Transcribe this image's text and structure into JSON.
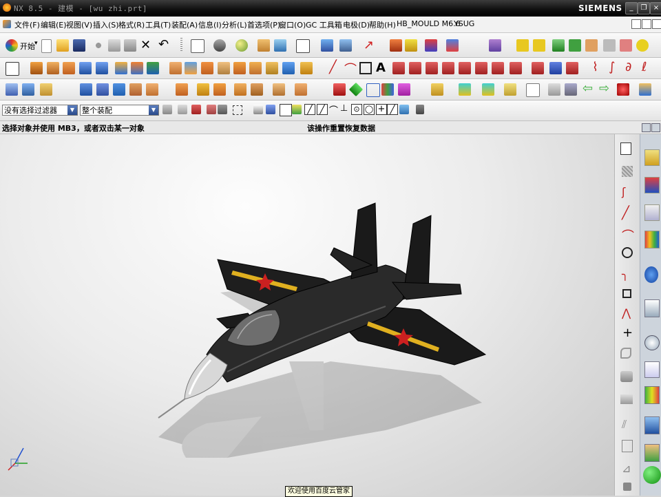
{
  "window": {
    "title": "NX 8.5 - 建模 - [wu zhi.prt]",
    "brand": "SIEMENS",
    "controls": [
      "_",
      "❐",
      "×"
    ]
  },
  "menubar": {
    "items": [
      {
        "label": "文件(F)"
      },
      {
        "label": "编辑(E)"
      },
      {
        "label": "视图(V)"
      },
      {
        "label": "插入(S)"
      },
      {
        "label": "格式(R)"
      },
      {
        "label": "工具(T)"
      },
      {
        "label": "装配(A)"
      },
      {
        "label": "信息(I)"
      },
      {
        "label": "分析(L)"
      },
      {
        "label": "首选项(P)"
      },
      {
        "label": "窗口(O)"
      },
      {
        "label": "GC 工具箱"
      },
      {
        "label": "电极(D)"
      },
      {
        "label": "帮助(H)"
      },
      {
        "label": "HB_MOULD M6.6"
      },
      {
        "label": "YSUG"
      }
    ]
  },
  "standard_toolbar": {
    "start_label": "开始",
    "start_arrow": "▾"
  },
  "filter_row": {
    "type_filter": "没有选择过滤器",
    "scope_filter": "整个装配",
    "arrow": "▼"
  },
  "cue_line": {
    "prompt": "选择对象并使用 MB3，或者双击某一对象",
    "status": "该操作重置恢复数据"
  },
  "statusbar": {
    "tooltip": "欢迎使用百度云管家"
  },
  "colors": {
    "titlebar": "#000000",
    "accent_blue": "#2a4a8a",
    "aircraft": "#1c1c1c",
    "star_red": "#cc2020",
    "stripe_yellow": "#e0b020"
  }
}
